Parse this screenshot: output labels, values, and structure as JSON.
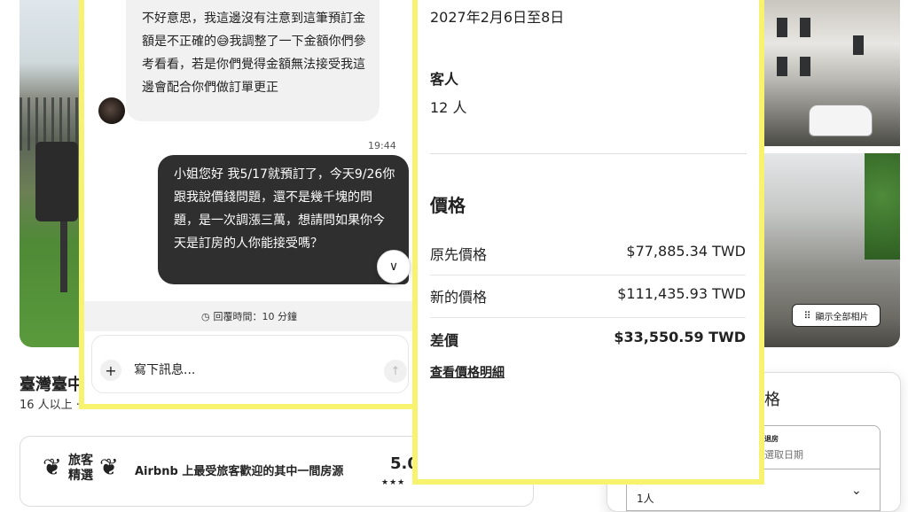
{
  "listing": {
    "title": "臺灣臺中",
    "subtitle": "16 人以上 ·",
    "guest_favorite": {
      "label_line1": "旅客",
      "label_line2": "精選",
      "description": "Airbnb 上最受旅客歡迎的其中一間房源",
      "rating": "5.0",
      "stars": "★★★"
    },
    "show_all_photos": "顯示全部相片",
    "price_card": {
      "title": "格",
      "checkout_label": "退房",
      "checkout_value": "選取日期",
      "guests_label": "房客",
      "guests_value": "1人"
    }
  },
  "chat": {
    "incoming_message": "不好意思，我這邊沒有注意到這筆預訂金額是不正確的😅我調整了一下金額你們參考看看，若是你們覺得金額無法接受我這邊會配合你們做訂單更正",
    "outgoing_time": "19:44",
    "outgoing_message": "小姐您好 我5/17就預訂了，今天9/26你跟我說價錢問題，還不是幾千塊的問題，是一次調漲三萬，想請問如果你今天是訂房的人你能接受嗎？",
    "reply_time": "回覆時間：10 分鐘",
    "input_placeholder": "寫下訊息..."
  },
  "booking": {
    "dates": "2027年2月6日至8日",
    "guests_heading": "客人",
    "guests_value": "12 人",
    "price_heading": "價格",
    "rows": [
      {
        "label": "原先價格",
        "value": "$77,885.34 TWD"
      },
      {
        "label": "新的價格",
        "value": "$111,435.93 TWD"
      },
      {
        "label": "差價",
        "value": "$33,550.59 TWD"
      }
    ],
    "details_link": "查看價格明細"
  },
  "colors": {
    "highlight_border": "#f7f36e",
    "outgoing_bubble": "#2f2f2f",
    "incoming_bubble": "#f1f1f1"
  }
}
